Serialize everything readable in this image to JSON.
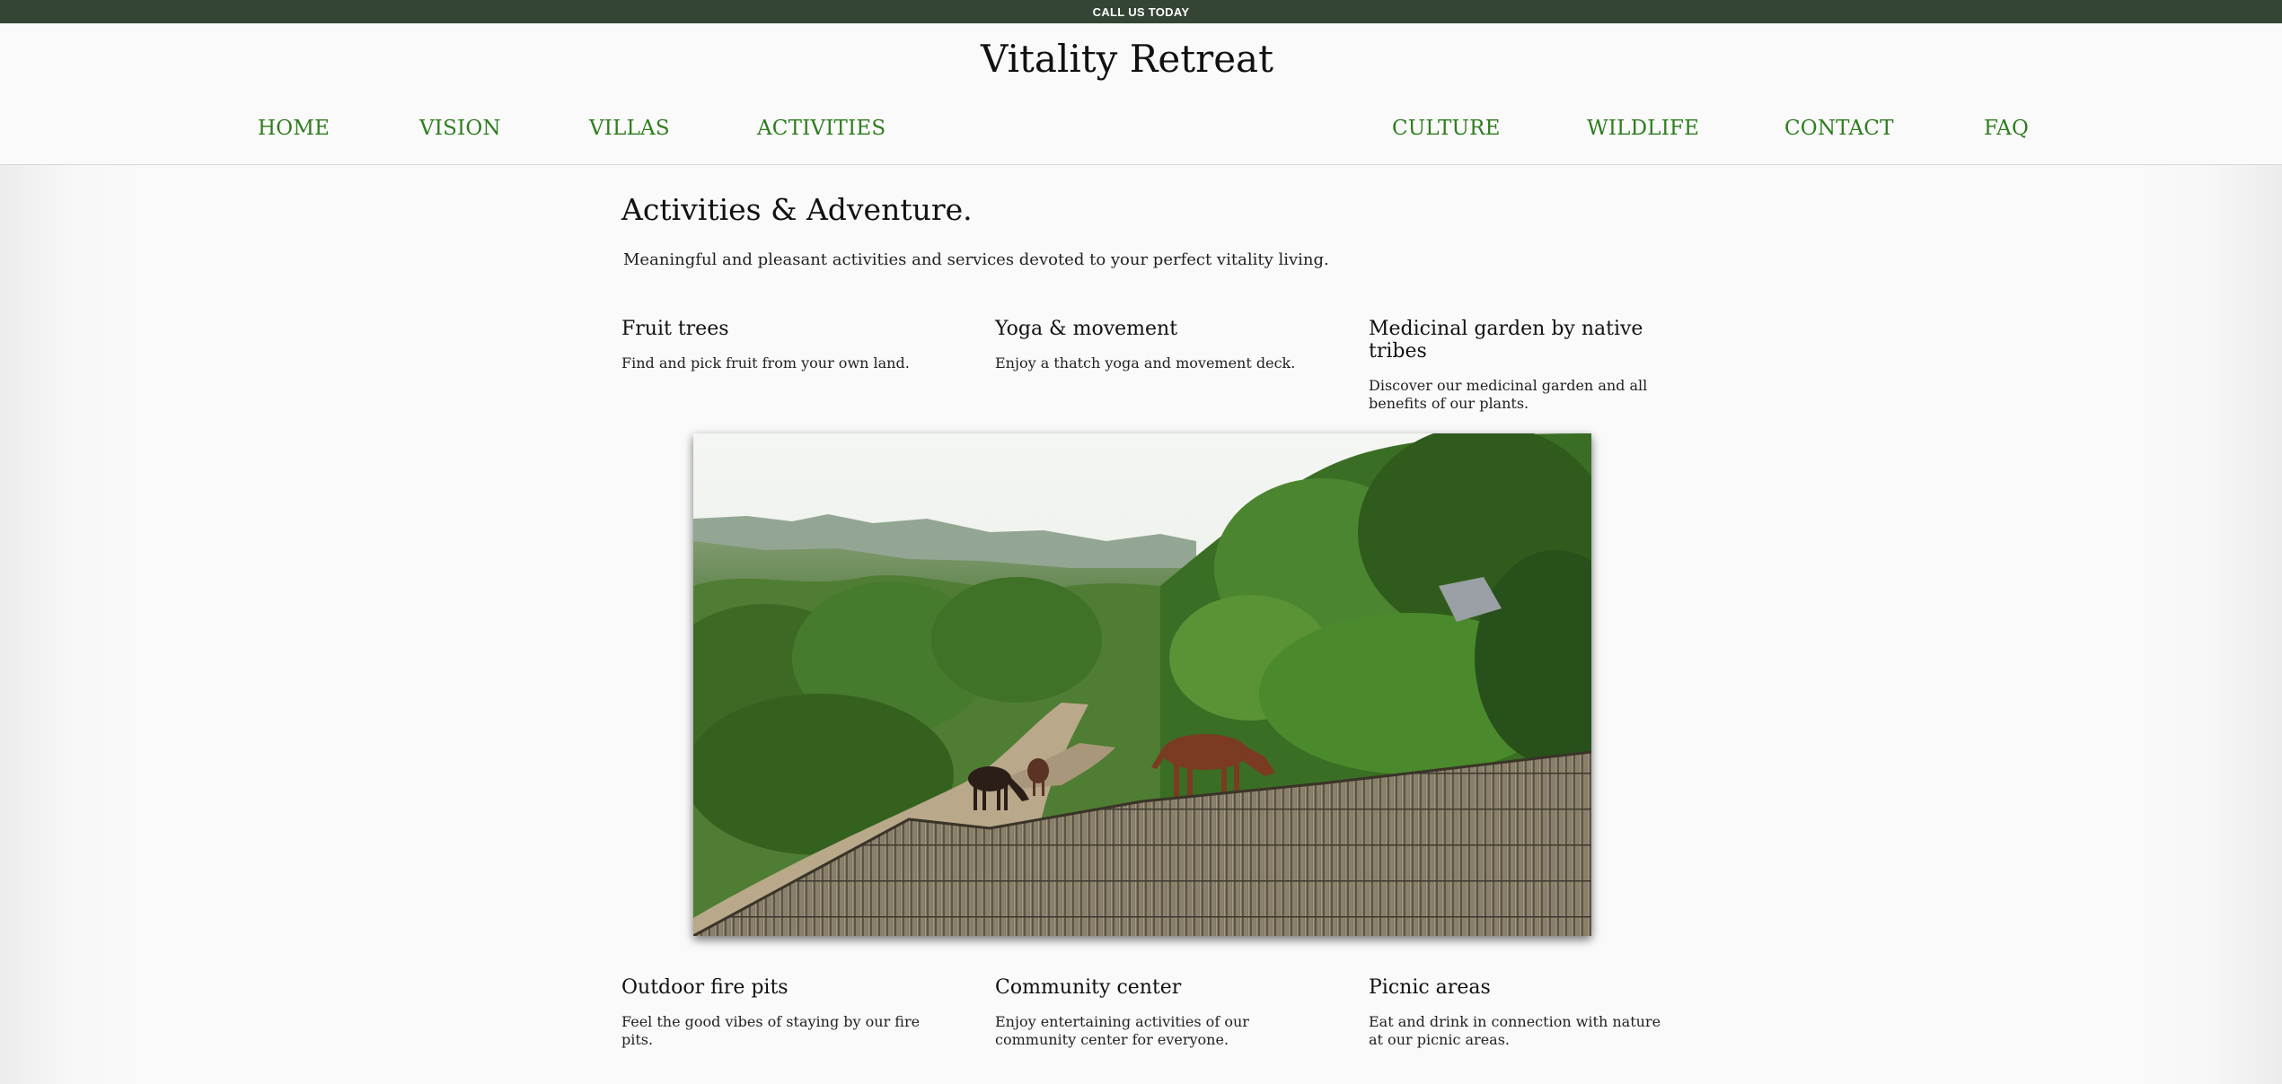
{
  "topbar": {
    "text": "CALL US TODAY"
  },
  "header": {
    "site_title": "Vitality Retreat",
    "nav": [
      "HOME",
      "VISION",
      "VILLAS",
      "ACTIVITIES",
      "CULTURE",
      "WILDLIFE",
      "CONTACT",
      "FAQ"
    ]
  },
  "colors": {
    "topbar_bg": "#344534",
    "nav_link": "#2e7d1e",
    "page_bg": "#fafafa"
  },
  "content": {
    "heading": "Activities & Adventure.",
    "intro": "Meaningful and pleasant activities and services devoted to your perfect vitality living.",
    "features_top": [
      {
        "title": "Fruit trees",
        "desc": "Find and pick fruit from your own land."
      },
      {
        "title": "Yoga & movement",
        "desc": "Enjoy a thatch yoga and movement deck."
      },
      {
        "title": "Medicinal garden by native tribes",
        "desc": "Discover our medicinal garden and all benefits of our plants."
      }
    ],
    "image": {
      "description": "horses-grazing-by-bamboo-fence-in-green-valley"
    },
    "features_bottom": [
      {
        "title": "Outdoor fire pits",
        "desc": "Feel the good vibes of staying by our fire pits."
      },
      {
        "title": "Community center",
        "desc": "Enjoy entertaining activities of our community center for everyone."
      },
      {
        "title": "Picnic areas",
        "desc": "Eat and drink in connection with nature at our picnic areas."
      }
    ]
  }
}
